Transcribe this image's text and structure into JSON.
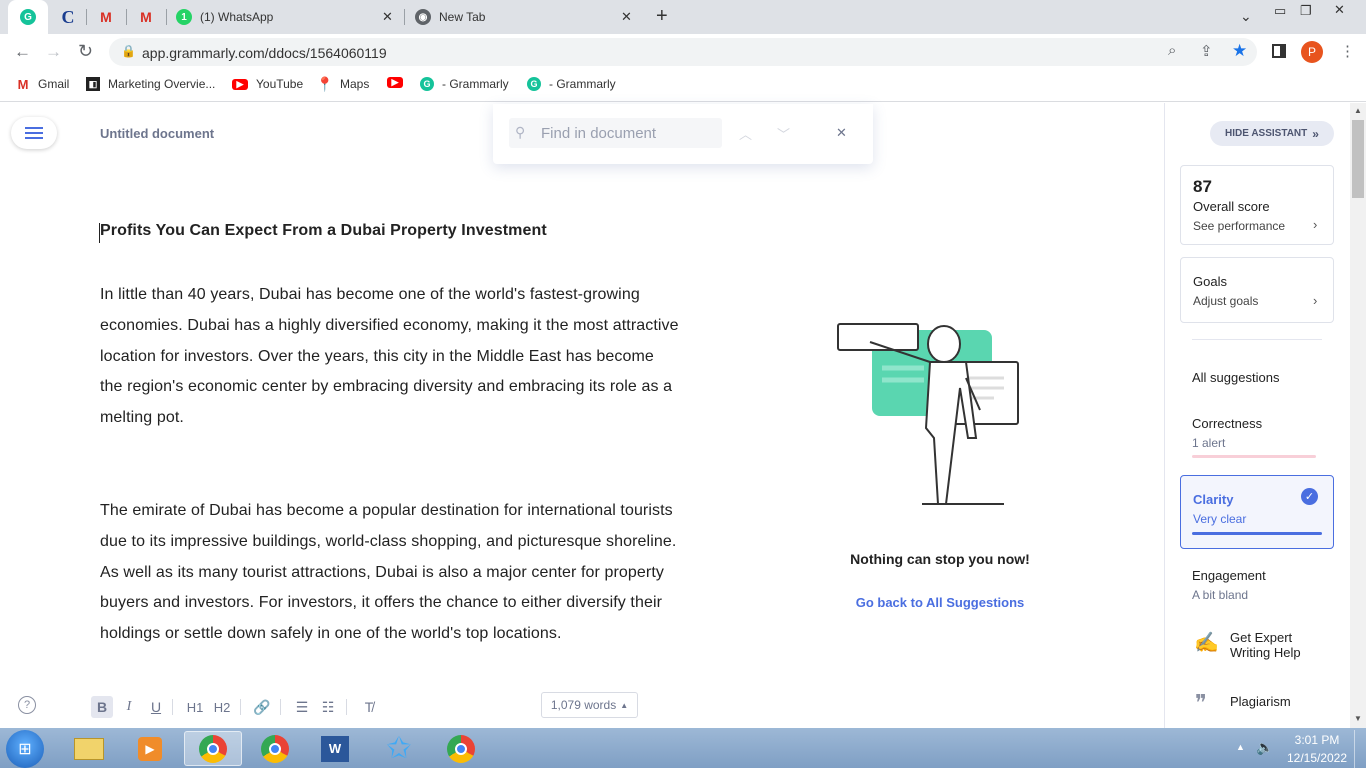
{
  "browser": {
    "tabs": [
      {
        "label": ""
      },
      {
        "label": ""
      },
      {
        "label": ""
      },
      {
        "label": ""
      },
      {
        "label": "(1) WhatsApp"
      },
      {
        "label": "New Tab"
      }
    ],
    "url": "app.grammarly.com/ddocs/1564060119",
    "profile_initial": "P",
    "bookmarks": [
      {
        "label": "Gmail",
        "icon": "gmail-icon"
      },
      {
        "label": "Marketing Overvie...",
        "icon": "marketing-icon"
      },
      {
        "label": "YouTube",
        "icon": "youtube-icon"
      },
      {
        "label": "Maps",
        "icon": "maps-icon"
      },
      {
        "label": "",
        "icon": "youtube-icon"
      },
      {
        "label": "- Grammarly",
        "icon": "grammarly-icon"
      },
      {
        "label": "- Grammarly",
        "icon": "grammarly-icon"
      }
    ]
  },
  "doc": {
    "title": "Untitled document",
    "find_placeholder": "Find in document",
    "heading": "Profits You Can Expect From a Dubai Property Investment",
    "paragraph1": "In little than 40 years, Dubai has become one of the world's fastest-growing economies. Dubai has a highly diversified economy, making it the most attractive location for investors. Over the years, this city in the Middle East has become the region's economic center by embracing diversity and embracing its role as a melting pot.",
    "paragraph2": "The emirate of Dubai has become a popular destination for international tourists due to its impressive buildings, world-class shopping, and picturesque shoreline. As well as its many tourist attractions, Dubai is also a major center for property buyers and investors. For investors, it offers the chance to either diversify their holdings or settle down safely in one of the world's top locations.",
    "empty_state_title": "Nothing can stop you now!",
    "back_link": "Go back to All Suggestions",
    "word_count": "1,079 words",
    "format_buttons": [
      "B",
      "I",
      "U",
      "H1",
      "H2"
    ]
  },
  "assistant": {
    "hide_label": "HIDE ASSISTANT",
    "score": "87",
    "score_label": "Overall score",
    "score_link": "See performance",
    "goals_label": "Goals",
    "goals_link": "Adjust goals",
    "all_suggestions": "All suggestions",
    "correctness": "Correctness",
    "correctness_sub": "1 alert",
    "clarity": "Clarity",
    "clarity_sub": "Very clear",
    "engagement": "Engagement",
    "engagement_sub": "A bit bland",
    "expert": "Get Expert Writing Help",
    "plagiarism": "Plagiarism"
  },
  "taskbar": {
    "time": "3:01 PM",
    "date": "12/15/2022"
  },
  "colors": {
    "accent": "#4a6ee0",
    "grammarly_green": "#15c39a",
    "correctness_red": "#f0a1b2",
    "illustration_teal": "#5ad6b0"
  }
}
